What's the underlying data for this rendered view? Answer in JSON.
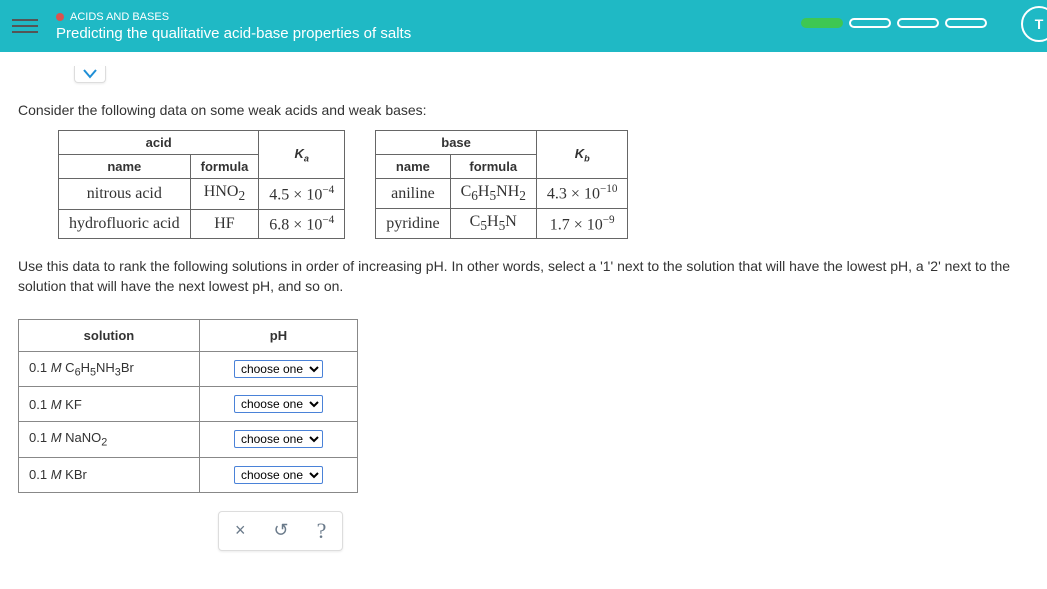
{
  "header": {
    "category": "ACIDS AND BASES",
    "title": "Predicting the qualitative acid-base properties of salts",
    "corner_letter": "T"
  },
  "intro": "Consider the following data on some weak acids and weak bases:",
  "acid_table": {
    "group_header": "acid",
    "name_header": "name",
    "formula_header": "formula",
    "k_header_base": "K",
    "k_header_sub": "a",
    "rows": [
      {
        "name": "nitrous acid",
        "formula_html": "HNO<sub>2</sub>",
        "k_coef": "4.5 × 10",
        "k_exp": "−4"
      },
      {
        "name": "hydrofluoric acid",
        "formula_html": "HF",
        "k_coef": "6.8 × 10",
        "k_exp": "−4"
      }
    ]
  },
  "base_table": {
    "group_header": "base",
    "name_header": "name",
    "formula_header": "formula",
    "k_header_base": "K",
    "k_header_sub": "b",
    "rows": [
      {
        "name": "aniline",
        "formula_html": "C<sub>6</sub>H<sub>5</sub>NH<sub>2</sub>",
        "k_coef": "4.3 × 10",
        "k_exp": "−10"
      },
      {
        "name": "pyridine",
        "formula_html": "C<sub>5</sub>H<sub>5</sub>N",
        "k_coef": "1.7 × 10",
        "k_exp": "−9"
      }
    ]
  },
  "rank_instructions": "Use this data to rank the following solutions in order of increasing pH. In other words, select a '1' next to the solution that will have the lowest pH, a '2' next to the solution that will have the next lowest pH, and so on.",
  "rank_table": {
    "solution_header": "solution",
    "ph_header": "pH",
    "dropdown_label": "choose one",
    "rows": [
      {
        "conc": "0.1",
        "unit": "M",
        "formula_html": "C<sub>6</sub>H<sub>5</sub>NH<sub>3</sub>Br"
      },
      {
        "conc": "0.1",
        "unit": "M",
        "formula_html": "KF"
      },
      {
        "conc": "0.1",
        "unit": "M",
        "formula_html": "NaNO<sub>2</sub>"
      },
      {
        "conc": "0.1",
        "unit": "M",
        "formula_html": "KBr"
      }
    ]
  },
  "actions": {
    "clear": "×",
    "reset": "↺",
    "help": "?"
  }
}
